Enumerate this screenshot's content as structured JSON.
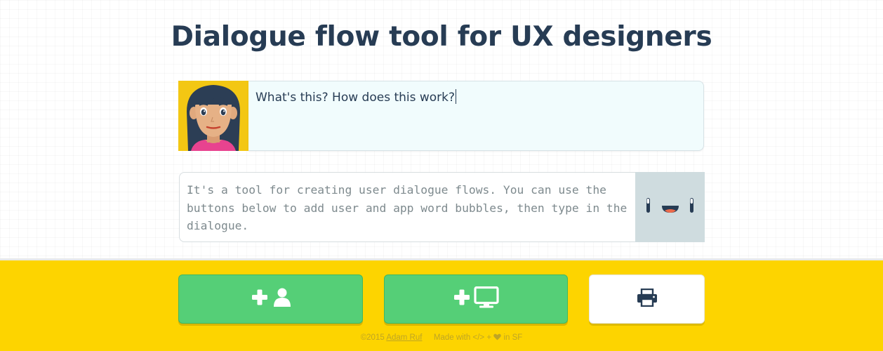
{
  "page": {
    "title": "Dialogue flow tool for UX designers"
  },
  "dialogue": {
    "user_bubble": {
      "avatar_icon": "woman-avatar-icon",
      "text": "What's this? How does this work?"
    },
    "app_bubble": {
      "avatar_icon": "robot-face-icon",
      "text": "It's a tool for creating user dialogue flows. You can use the buttons below to add user and app word bubbles, then type in the dialogue."
    }
  },
  "toolbar": {
    "add_user_icon": "plus-user-icon",
    "add_app_icon": "plus-desktop-icon",
    "print_icon": "printer-icon"
  },
  "footer": {
    "copyright": "©2015",
    "author": "Adam Ruf",
    "made_with_prefix": "Made with",
    "code_symbol": "</>",
    "plus": "+",
    "heart_icon": "heart-icon",
    "location": "in SF"
  },
  "colors": {
    "title": "#273c54",
    "toolbar_bg": "#fdd400",
    "button_green": "#55cf77",
    "user_bubble_bg": "#f1fcfd",
    "app_avatar_bg": "#cfdcdf",
    "user_avatar_bg": "#f3c713"
  }
}
